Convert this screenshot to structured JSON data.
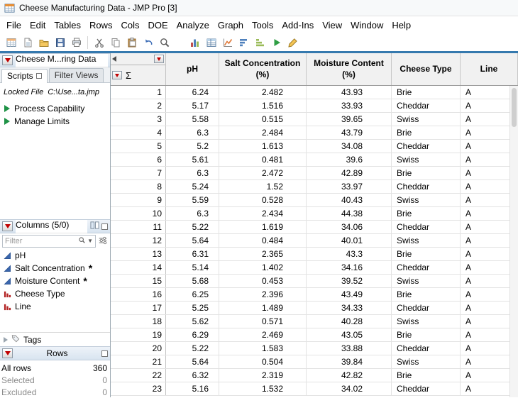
{
  "window": {
    "title": "Cheese Manufacturing Data - JMP Pro [3]"
  },
  "menubar": [
    "File",
    "Edit",
    "Tables",
    "Rows",
    "Cols",
    "DOE",
    "Analyze",
    "Graph",
    "Tools",
    "Add-Ins",
    "View",
    "Window",
    "Help"
  ],
  "toolbar": {
    "groups": [
      [
        "new-data-table-icon",
        "new-journal-icon",
        "open-icon",
        "save-icon",
        "print-icon"
      ],
      [
        "cut-icon",
        "copy-icon",
        "paste-icon",
        "undo-icon",
        "zoom-icon"
      ],
      [
        "distribution-icon",
        "tabulate-icon",
        "graph-builder-icon",
        "sort-bars-icon",
        "summary-bars-icon",
        "run-script-icon",
        "annotate-icon"
      ]
    ]
  },
  "sidebar": {
    "table_panel": {
      "title": "Cheese M...ring Data",
      "tabs": [
        {
          "label": "Scripts",
          "active": true
        },
        {
          "label": "Filter Views",
          "active": false
        }
      ],
      "locked_label": "Locked File",
      "file_path": "C:\\Use...ta.jmp",
      "scripts": [
        "Process Capability",
        "Manage Limits"
      ]
    },
    "columns_panel": {
      "title": "Columns (5/0)",
      "filter_placeholder": "Filter",
      "items": [
        {
          "name": "pH",
          "type": "continuous",
          "flag": ""
        },
        {
          "name": "Salt Concentration",
          "type": "continuous",
          "flag": "*"
        },
        {
          "name": "Moisture Content",
          "type": "continuous",
          "flag": "*"
        },
        {
          "name": "Cheese Type",
          "type": "nominal",
          "flag": ""
        },
        {
          "name": "Line",
          "type": "nominal",
          "flag": ""
        }
      ],
      "tags_label": "Tags"
    },
    "rows_panel": {
      "title": "Rows",
      "stats": [
        {
          "label": "All rows",
          "value": "360"
        },
        {
          "label": "Selected",
          "value": "0"
        },
        {
          "label": "Excluded",
          "value": "0"
        }
      ]
    }
  },
  "grid": {
    "corner_sigma": "Σ",
    "columns": [
      {
        "key": "ph",
        "line1": "pH",
        "line2": "",
        "align": "right"
      },
      {
        "key": "salt",
        "line1": "Salt Concentration",
        "line2": "(%)",
        "align": "right"
      },
      {
        "key": "moisture",
        "line1": "Moisture Content",
        "line2": "(%)",
        "align": "right"
      },
      {
        "key": "cheese",
        "line1": "Cheese Type",
        "line2": "",
        "align": "left"
      },
      {
        "key": "line",
        "line1": "Line",
        "line2": "",
        "align": "left"
      }
    ],
    "rows": [
      {
        "n": "1",
        "ph": "6.24",
        "salt": "2.482",
        "moisture": "43.93",
        "cheese": "Brie",
        "line": "A"
      },
      {
        "n": "2",
        "ph": "5.17",
        "salt": "1.516",
        "moisture": "33.93",
        "cheese": "Cheddar",
        "line": "A"
      },
      {
        "n": "3",
        "ph": "5.58",
        "salt": "0.515",
        "moisture": "39.65",
        "cheese": "Swiss",
        "line": "A"
      },
      {
        "n": "4",
        "ph": "6.3",
        "salt": "2.484",
        "moisture": "43.79",
        "cheese": "Brie",
        "line": "A"
      },
      {
        "n": "5",
        "ph": "5.2",
        "salt": "1.613",
        "moisture": "34.08",
        "cheese": "Cheddar",
        "line": "A"
      },
      {
        "n": "6",
        "ph": "5.61",
        "salt": "0.481",
        "moisture": "39.6",
        "cheese": "Swiss",
        "line": "A"
      },
      {
        "n": "7",
        "ph": "6.3",
        "salt": "2.472",
        "moisture": "42.89",
        "cheese": "Brie",
        "line": "A"
      },
      {
        "n": "8",
        "ph": "5.24",
        "salt": "1.52",
        "moisture": "33.97",
        "cheese": "Cheddar",
        "line": "A"
      },
      {
        "n": "9",
        "ph": "5.59",
        "salt": "0.528",
        "moisture": "40.43",
        "cheese": "Swiss",
        "line": "A"
      },
      {
        "n": "10",
        "ph": "6.3",
        "salt": "2.434",
        "moisture": "44.38",
        "cheese": "Brie",
        "line": "A"
      },
      {
        "n": "11",
        "ph": "5.22",
        "salt": "1.619",
        "moisture": "34.06",
        "cheese": "Cheddar",
        "line": "A"
      },
      {
        "n": "12",
        "ph": "5.64",
        "salt": "0.484",
        "moisture": "40.01",
        "cheese": "Swiss",
        "line": "A"
      },
      {
        "n": "13",
        "ph": "6.31",
        "salt": "2.365",
        "moisture": "43.3",
        "cheese": "Brie",
        "line": "A"
      },
      {
        "n": "14",
        "ph": "5.14",
        "salt": "1.402",
        "moisture": "34.16",
        "cheese": "Cheddar",
        "line": "A"
      },
      {
        "n": "15",
        "ph": "5.68",
        "salt": "0.453",
        "moisture": "39.52",
        "cheese": "Swiss",
        "line": "A"
      },
      {
        "n": "16",
        "ph": "6.25",
        "salt": "2.396",
        "moisture": "43.49",
        "cheese": "Brie",
        "line": "A"
      },
      {
        "n": "17",
        "ph": "5.25",
        "salt": "1.489",
        "moisture": "34.33",
        "cheese": "Cheddar",
        "line": "A"
      },
      {
        "n": "18",
        "ph": "5.62",
        "salt": "0.571",
        "moisture": "40.28",
        "cheese": "Swiss",
        "line": "A"
      },
      {
        "n": "19",
        "ph": "6.29",
        "salt": "2.469",
        "moisture": "43.05",
        "cheese": "Brie",
        "line": "A"
      },
      {
        "n": "20",
        "ph": "5.22",
        "salt": "1.583",
        "moisture": "33.88",
        "cheese": "Cheddar",
        "line": "A"
      },
      {
        "n": "21",
        "ph": "5.64",
        "salt": "0.504",
        "moisture": "39.84",
        "cheese": "Swiss",
        "line": "A"
      },
      {
        "n": "22",
        "ph": "6.32",
        "salt": "2.319",
        "moisture": "42.82",
        "cheese": "Brie",
        "line": "A"
      },
      {
        "n": "23",
        "ph": "5.16",
        "salt": "1.532",
        "moisture": "34.02",
        "cheese": "Cheddar",
        "line": "A"
      }
    ]
  }
}
